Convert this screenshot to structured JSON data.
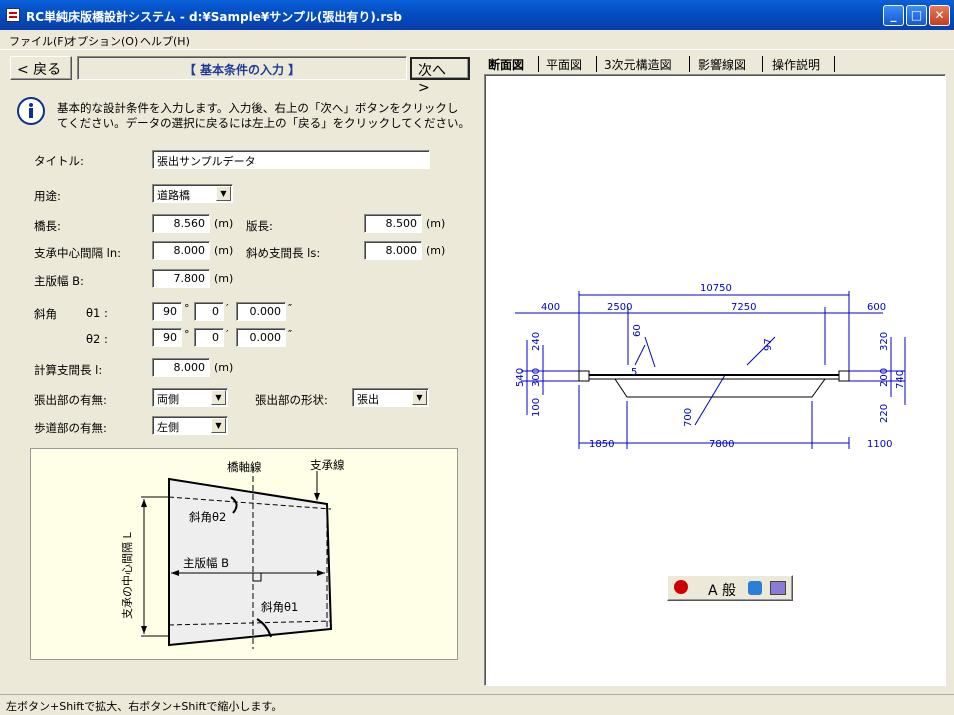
{
  "window": {
    "title": "RC単純床版橋設計システム - d:¥Sample¥サンプル(張出有り).rsb"
  },
  "menu": [
    "ファイル(F)",
    "オプション(O)",
    "ヘルプ(H)"
  ],
  "nav": {
    "back": "< 戻る",
    "section_title": "【 基本条件の入力 】",
    "next": "次へ >"
  },
  "info": {
    "text1": "基本的な設計条件を入力します。入力後、右上の「次へ」ボタンをクリックし",
    "text2": "てください。データの選択に戻るには左上の「戻る」をクリックしてください。"
  },
  "form": {
    "title_label": "タイトル:",
    "title_value": "張出サンプルデータ",
    "usage_label": "用途:",
    "usage_value": "道路橋",
    "bridge_length_label": "橋長:",
    "bridge_length_value": "8.560",
    "slab_length_label": "版長:",
    "slab_length_value": "8.500",
    "unit_m": "(m)",
    "bearing_span_label": "支承中心間隔 ln:",
    "bearing_span_value": "8.000",
    "skew_span_label": "斜め支間長 ls:",
    "skew_span_value": "8.000",
    "width_label": "主版幅 B:",
    "width_value": "7.800",
    "skew_label": "斜角",
    "theta1_label": "θ1 :",
    "theta1_deg": "90",
    "theta1_min": "0",
    "theta1_sec": "0.000",
    "theta2_label": "θ2 :",
    "theta2_deg": "90",
    "theta2_min": "0",
    "theta2_sec": "0.000",
    "deg_mark": "°",
    "min_mark": "′",
    "sec_mark": "″",
    "calc_span_label": "計算支間長 l:",
    "calc_span_value": "8.000",
    "overhang_label": "張出部の有無:",
    "overhang_value": "両側",
    "overhang_shape_label": "張出部の形状:",
    "overhang_shape_value": "張出",
    "sidewalk_label": "歩道部の有無:",
    "sidewalk_value": "左側"
  },
  "diagram": {
    "axis_line": "橋軸線",
    "bearing_line": "支承線",
    "skew2": "斜角θ2",
    "width": "主版幅 B",
    "span": "支承の中心間隔 L",
    "skew1": "斜角θ1"
  },
  "tabs": [
    "断面図",
    "平面図",
    "3次元構造図",
    "影響線図",
    "操作説明"
  ],
  "section_drawing": {
    "dims": [
      "10750",
      "400",
      "2500",
      "7250",
      "600",
      "60",
      "97",
      "240",
      "320",
      "540",
      "300",
      "200",
      "740",
      "100",
      "220",
      "5",
      "700",
      "1850",
      "7800",
      "1100"
    ]
  },
  "toolbar": {
    "text": "A 般"
  },
  "status": "左ボタン+Shiftで拡大、右ボタン+Shiftで縮小します。"
}
